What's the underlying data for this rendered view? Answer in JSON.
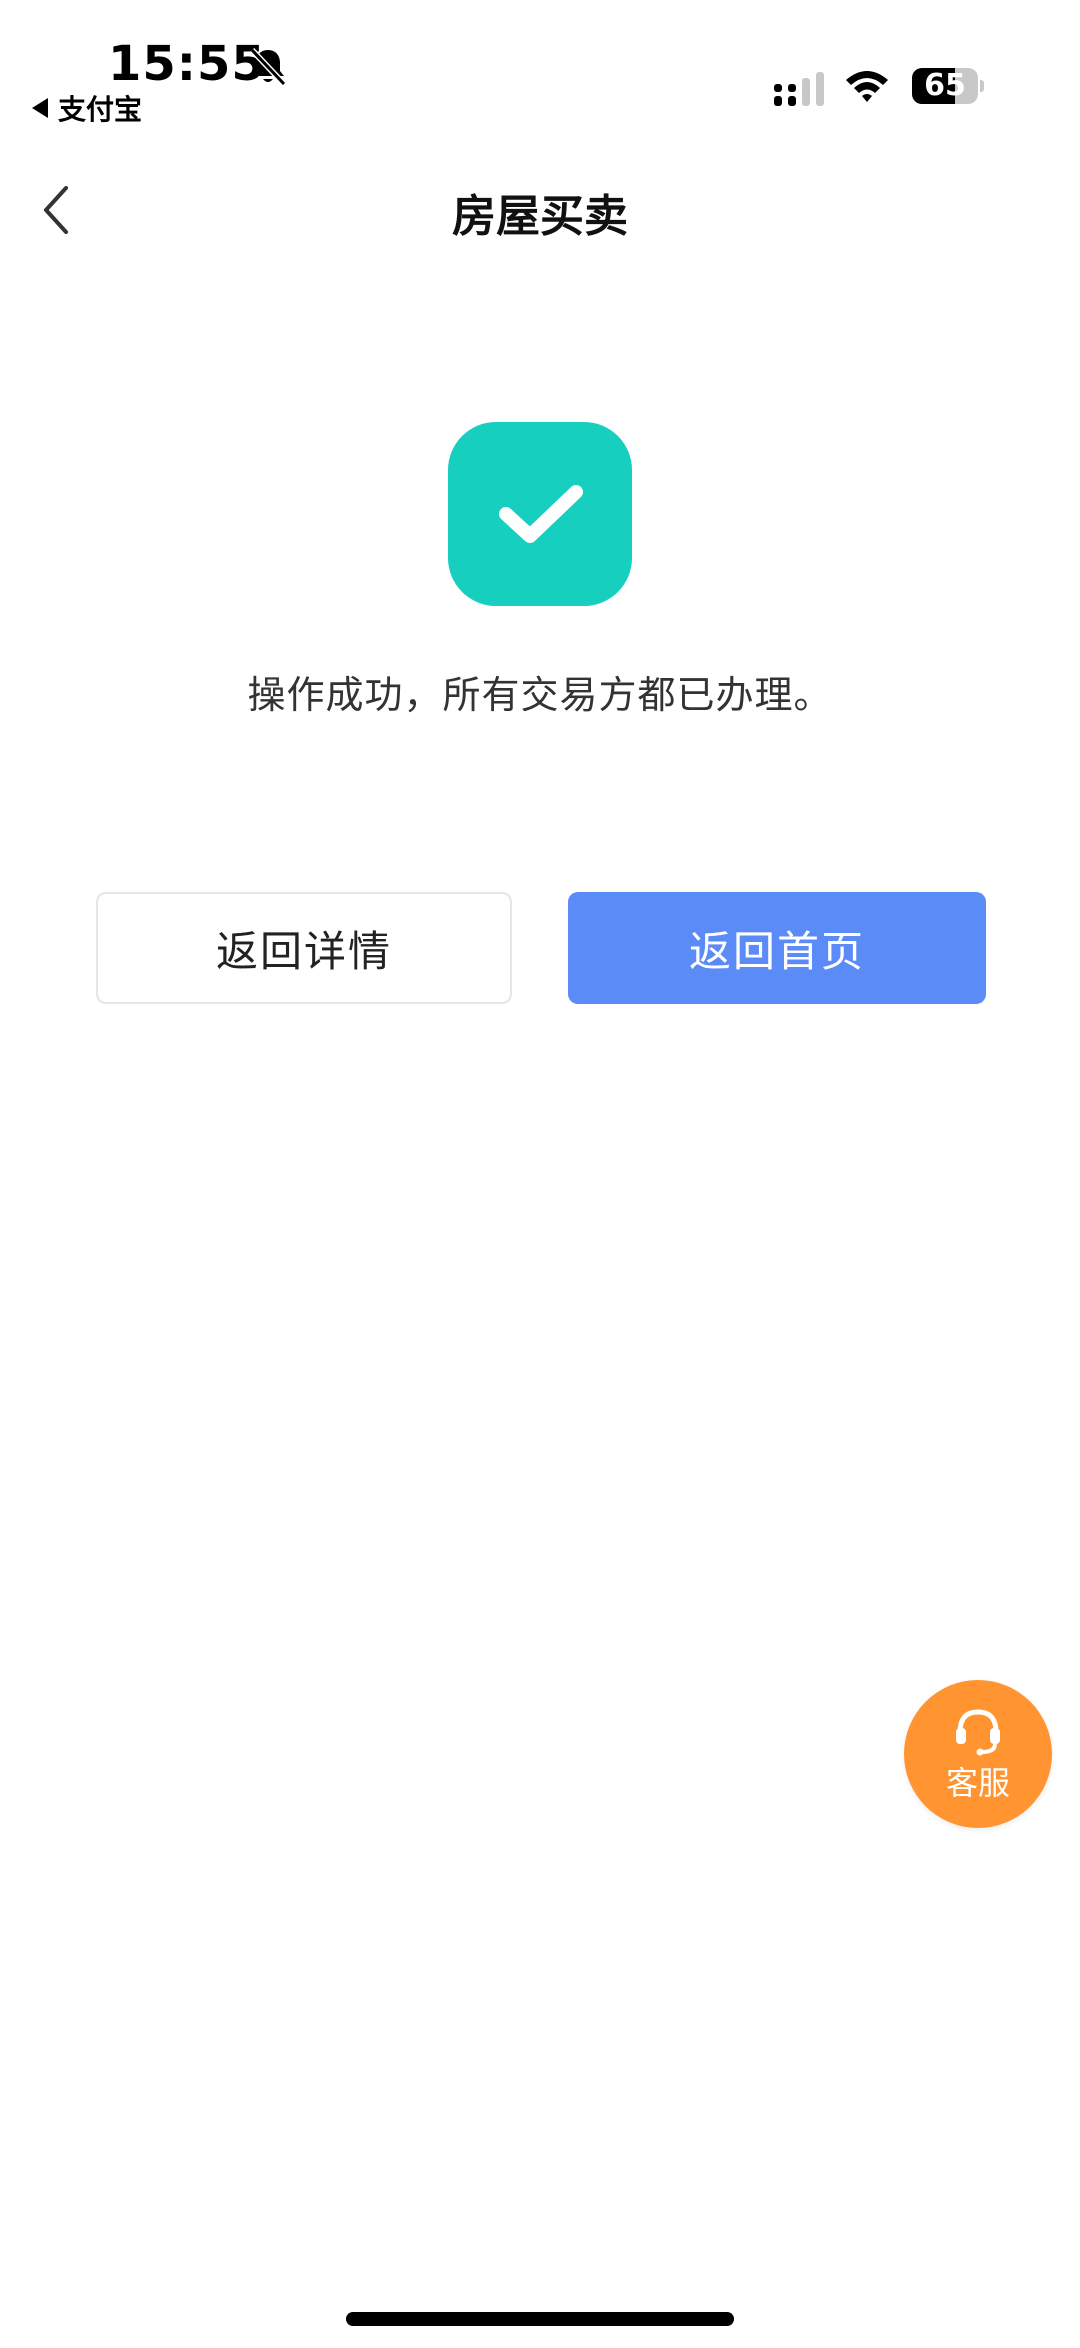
{
  "status_bar": {
    "time": "15:55",
    "back_app_label": "支付宝",
    "battery_level": "65",
    "battery_fraction": 0.65
  },
  "nav": {
    "title": "房屋买卖"
  },
  "result": {
    "message": "操作成功，所有交易方都已办理。",
    "icon": "checkmark-icon",
    "icon_color": "#16cfbf"
  },
  "actions": {
    "back_to_detail": "返回详情",
    "back_to_home": "返回首页",
    "primary_color": "#5b8bf7"
  },
  "customer_service": {
    "label": "客服",
    "color": "#ff9431"
  }
}
